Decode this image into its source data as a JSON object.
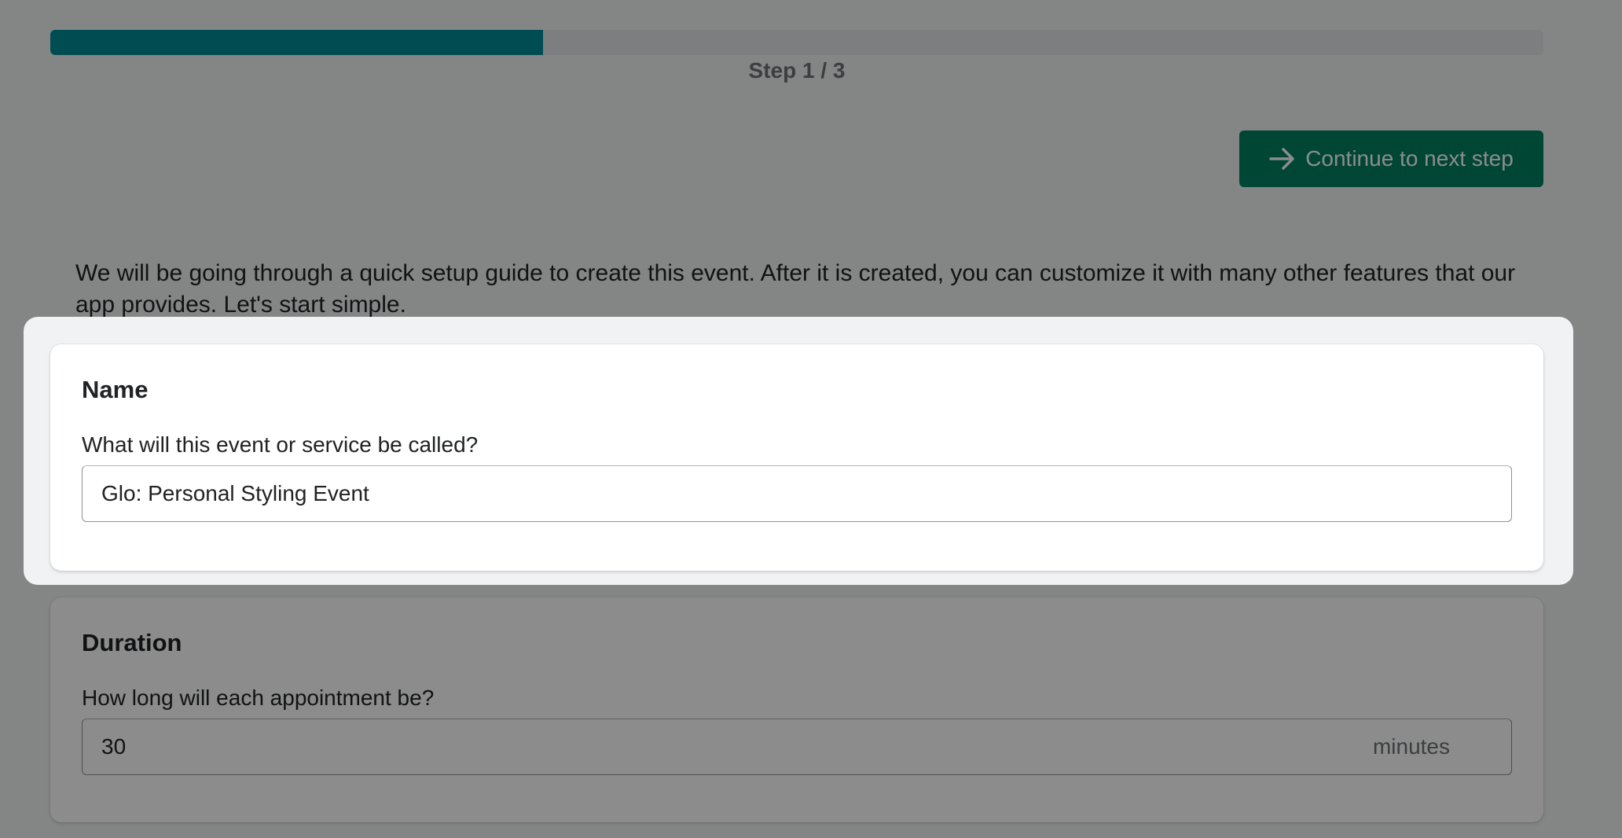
{
  "progress": {
    "fraction": 0.33,
    "step_label": "Step 1 / 3",
    "fill_color": "#008a98"
  },
  "toolbar": {
    "next_label": "Continue to next step",
    "next_icon": "arrow-right-icon",
    "button_color": "#008060"
  },
  "intro": {
    "text": "We will be going through a quick setup guide to create this event. After it is created, you can customize it with many other features that our app provides. Let's start simple."
  },
  "name_section": {
    "title": "Name",
    "label": "What will this event or service be called?",
    "value": "Glo: Personal Styling Event"
  },
  "duration_section": {
    "title": "Duration",
    "label": "How long will each appointment be?",
    "value": "30",
    "suffix": "minutes"
  }
}
